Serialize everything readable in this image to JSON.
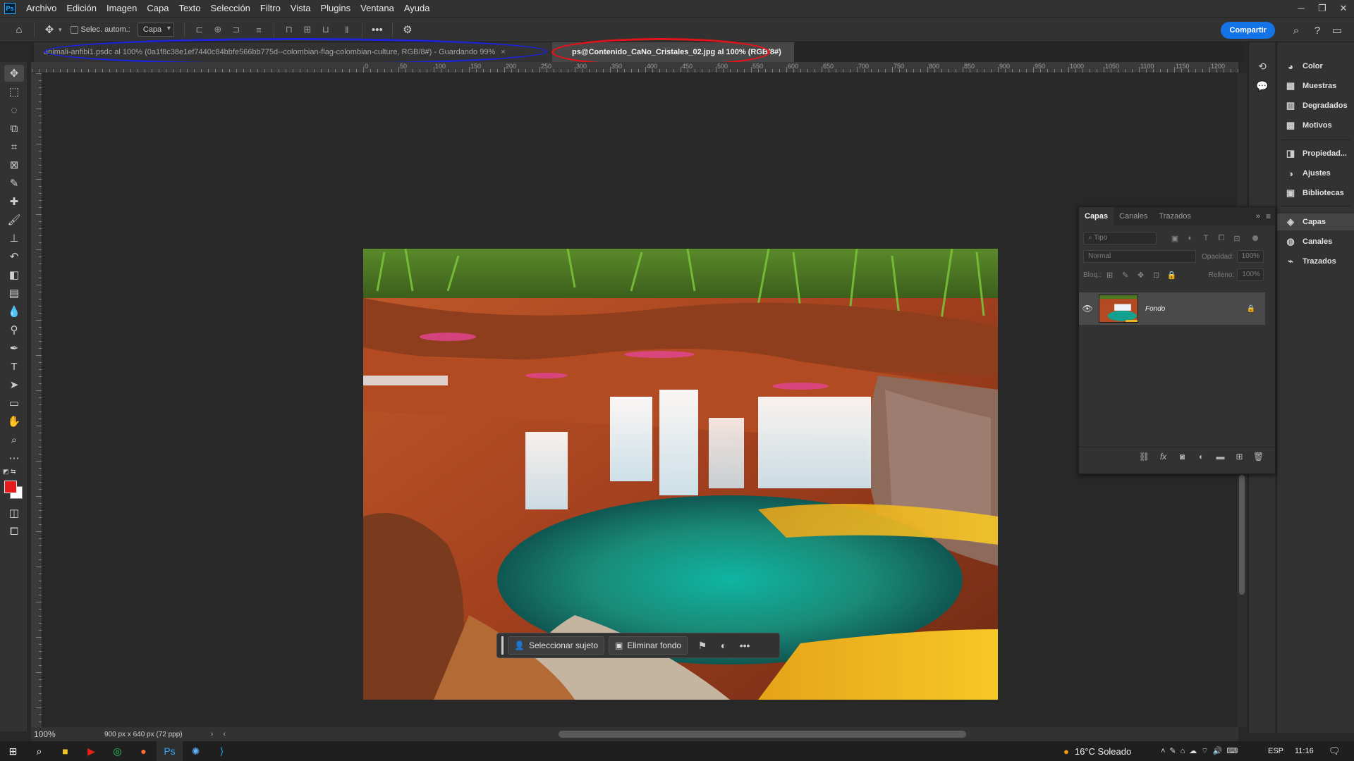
{
  "menu": {
    "app_icon_text": "Ps",
    "items": [
      "Archivo",
      "Edición",
      "Imagen",
      "Capa",
      "Texto",
      "Selección",
      "Filtro",
      "Vista",
      "Plugins",
      "Ventana",
      "Ayuda"
    ]
  },
  "options_bar": {
    "auto_select_label": "Selec. autom.:",
    "layer_select_value": "Capa",
    "share_button": "Compartir"
  },
  "tabs": [
    {
      "label": "animali-anfibi1.psdc al 100% (0a1f8c38e1ef7440c84bbfe566bb775d--colombian-flag-colombian-culture, RGB/8#) - Guardando 99%",
      "active": false,
      "annotation_color": "#1c23d9"
    },
    {
      "label": "ps@Contenido_CaNo_Cristales_02.jpg al 100% (RGB/8#)",
      "active": true,
      "annotation_color": "#e1141c"
    }
  ],
  "ruler_top": [
    "0",
    "50",
    "100",
    "150",
    "200",
    "250",
    "300",
    "350",
    "400",
    "450",
    "500",
    "550",
    "600",
    "650",
    "700",
    "750",
    "800",
    "850",
    "900",
    "950",
    "1000",
    "1050",
    "1100",
    "1150",
    "1200",
    "1250"
  ],
  "canvas": {
    "image_description_icon": "landscape-photo"
  },
  "context_bar": {
    "select_subject": "Seleccionar sujeto",
    "remove_background": "Eliminar fondo"
  },
  "status_bar": {
    "zoom": "100%",
    "doc_info": "900 px x 640 px (72 ppp)"
  },
  "right_panel": {
    "groups": [
      {
        "label": "Color",
        "icon": "color-wheel-icon"
      },
      {
        "label": "Muestras",
        "icon": "swatches-grid-icon"
      },
      {
        "label": "Degradados",
        "icon": "gradient-icon"
      },
      {
        "label": "Motivos",
        "icon": "patterns-icon"
      },
      {
        "label": "Propiedad...",
        "icon": "properties-icon"
      },
      {
        "label": "Ajustes",
        "icon": "adjustments-icon"
      },
      {
        "label": "Bibliotecas",
        "icon": "libraries-icon"
      },
      {
        "label": "Capas",
        "icon": "layers-icon"
      },
      {
        "label": "Canales",
        "icon": "channels-icon"
      },
      {
        "label": "Trazados",
        "icon": "paths-icon"
      }
    ]
  },
  "layers_panel": {
    "tabs": [
      "Capas",
      "Canales",
      "Trazados"
    ],
    "search_placeholder": "Tipo",
    "blend_mode": "Normal",
    "opacity_label": "Opacidad:",
    "opacity_value": "100%",
    "lock_label": "Bloq.:",
    "fill_label": "Relleno:",
    "fill_value": "100%",
    "layers": [
      {
        "name": "Fondo",
        "locked": true,
        "visible": true
      }
    ]
  },
  "taskbar": {
    "weather": "16°C  Soleado",
    "language": "ESP",
    "time": "11:16"
  }
}
